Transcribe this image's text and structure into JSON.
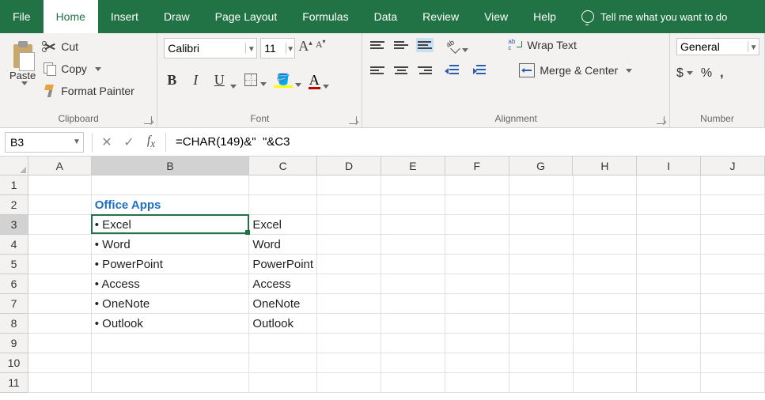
{
  "tabs": {
    "list": [
      "File",
      "Home",
      "Insert",
      "Draw",
      "Page Layout",
      "Formulas",
      "Data",
      "Review",
      "View",
      "Help"
    ],
    "active": "Home",
    "tellme": "Tell me what you want to do"
  },
  "ribbon": {
    "clipboard": {
      "label": "Clipboard",
      "paste": "Paste",
      "cut": "Cut",
      "copy": "Copy",
      "fp": "Format Painter"
    },
    "font": {
      "label": "Font",
      "name": "Calibri",
      "size": "11"
    },
    "alignment": {
      "label": "Alignment",
      "wrap": "Wrap Text",
      "merge": "Merge & Center"
    },
    "number": {
      "label": "Number",
      "format": "General"
    }
  },
  "formula_bar": {
    "name_box": "B3",
    "formula": "=CHAR(149)&\"  \"&C3"
  },
  "grid": {
    "columns": [
      "A",
      "B",
      "C",
      "D",
      "E",
      "F",
      "G",
      "H",
      "I",
      "J"
    ],
    "active_col": "B",
    "active_row": 3,
    "row_count": 11,
    "cells": {
      "B2": "Office Apps",
      "B3": "• Excel",
      "C3": "Excel",
      "B4": "• Word",
      "C4": "Word",
      "B5": "• PowerPoint",
      "C5": "PowerPoint",
      "B6": "• Access",
      "C6": "Access",
      "B7": "• OneNote",
      "C7": "OneNote",
      "B8": "• Outlook",
      "C8": "Outlook"
    }
  }
}
